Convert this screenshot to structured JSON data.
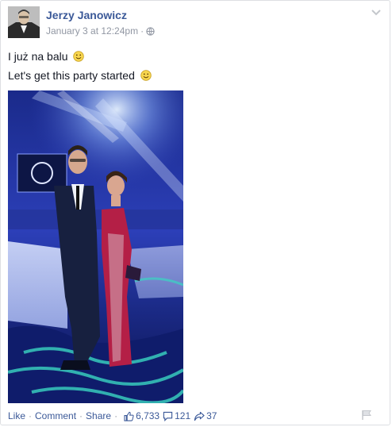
{
  "post": {
    "author": "Jerzy Janowicz",
    "timestamp": "January 3 at 12:24pm",
    "audience_icon": "globe-icon",
    "text_lines": [
      "I już na balu",
      "Let's get this party started"
    ],
    "emoji": "smiley-icon"
  },
  "actions": {
    "like": "Like",
    "comment": "Comment",
    "share": "Share",
    "likes_count": "6,733",
    "comments_count": "121",
    "shares_count": "37"
  },
  "colors": {
    "link": "#3b5998",
    "meta": "#9197a3",
    "text": "#141823"
  }
}
